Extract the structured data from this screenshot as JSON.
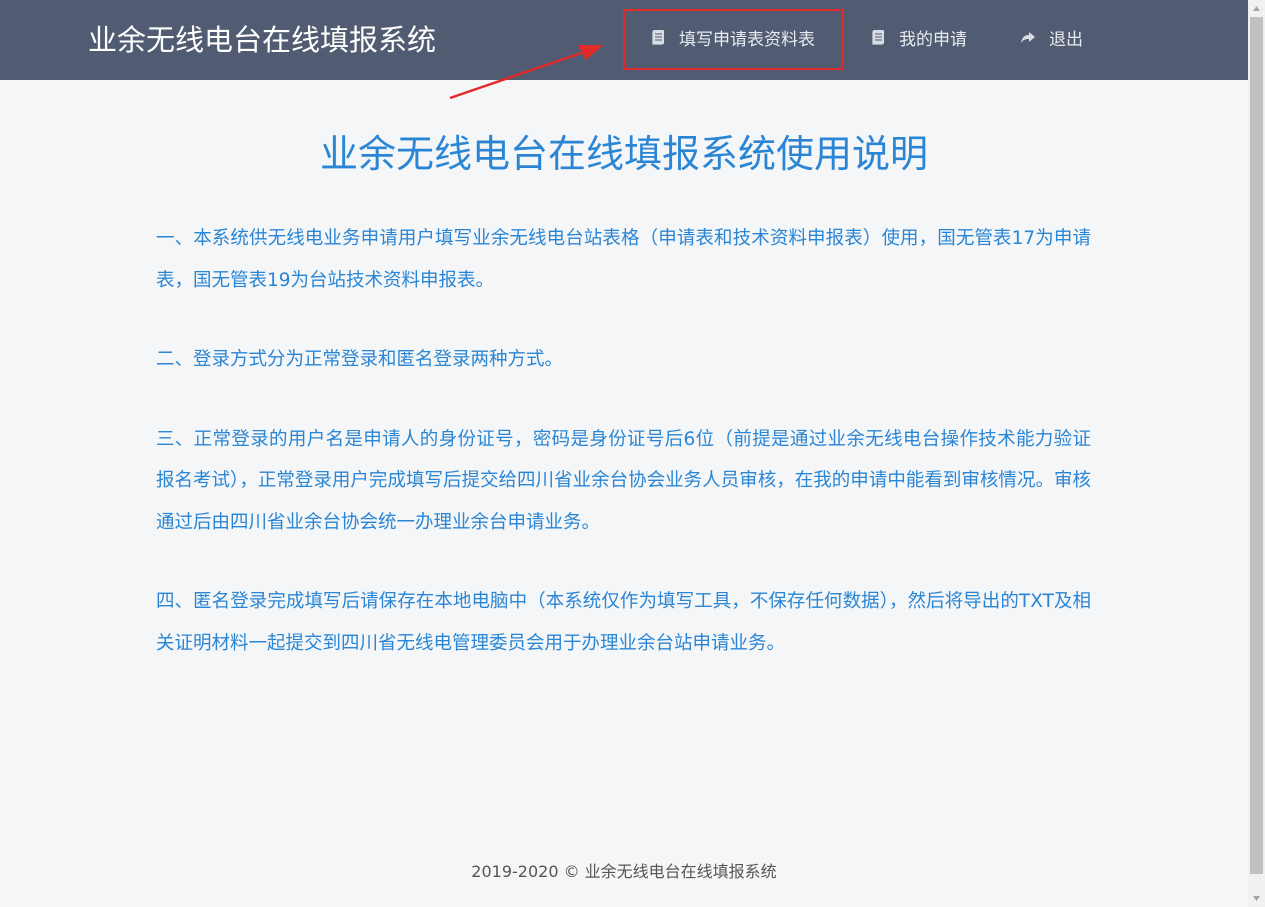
{
  "header": {
    "brand": "业余无线电台在线填报系统",
    "nav": [
      {
        "label": "填写申请表资料表",
        "icon": "document-icon"
      },
      {
        "label": "我的申请",
        "icon": "document-icon"
      },
      {
        "label": "退出",
        "icon": "share-arrow-icon"
      }
    ]
  },
  "main": {
    "title": "业余无线电台在线填报系统使用说明",
    "paragraphs": [
      "一、本系统供无线电业务申请用户填写业余无线电台站表格（申请表和技术资料申报表）使用，国无管表17为申请表，国无管表19为台站技术资料申报表。",
      "二、登录方式分为正常登录和匿名登录两种方式。",
      "三、正常登录的用户名是申请人的身份证号，密码是身份证号后6位（前提是通过业余无线电台操作技术能力验证报名考试），正常登录用户完成填写后提交给四川省业余台协会业务人员审核，在我的申请中能看到审核情况。审核通过后由四川省业余台协会统一办理业余台申请业务。",
      "四、匿名登录完成填写后请保存在本地电脑中（本系统仅作为填写工具，不保存任何数据），然后将导出的TXT及相关证明材料一起提交到四川省无线电管理委员会用于办理业余台站申请业务。"
    ]
  },
  "footer": {
    "text": "2019-2020 © 业余无线电台在线填报系统"
  },
  "colors": {
    "navbar": "#515c72",
    "accent_text": "#2a86d4",
    "annotation_red": "#e22a2a",
    "background": "#f5f6f8"
  }
}
